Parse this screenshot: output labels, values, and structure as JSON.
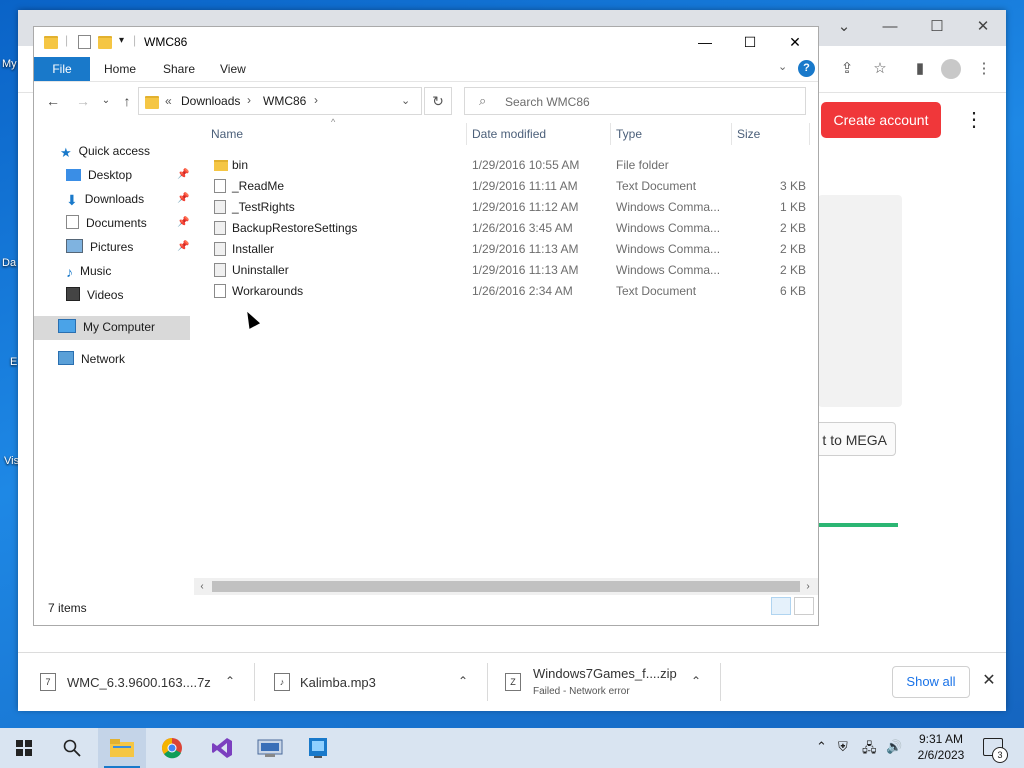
{
  "desktop": {
    "labels": [
      "My",
      "Da",
      "E",
      "Vis"
    ]
  },
  "chrome": {
    "create_account": "Create account",
    "mega_button": "t to MEGA",
    "downloads": [
      {
        "name": "WMC_6.3.9600.163....7z",
        "status": ""
      },
      {
        "name": "Kalimba.mp3",
        "status": ""
      },
      {
        "name": "Windows7Games_f....zip",
        "status": "Failed - Network error"
      }
    ],
    "show_all": "Show all"
  },
  "explorer": {
    "title": "WMC86",
    "ribbon": {
      "file": "File",
      "home": "Home",
      "share": "Share",
      "view": "View",
      "help": "?"
    },
    "address": {
      "prefix": "«",
      "crumbs": [
        "Downloads",
        "WMC86"
      ]
    },
    "search_placeholder": "Search WMC86",
    "nav": {
      "quick_access": "Quick access",
      "items": [
        "Desktop",
        "Downloads",
        "Documents",
        "Pictures",
        "Music",
        "Videos"
      ],
      "my_computer": "My Computer",
      "network": "Network"
    },
    "columns": {
      "name": "Name",
      "date": "Date modified",
      "type": "Type",
      "size": "Size"
    },
    "files": [
      {
        "name": "bin",
        "date": "1/29/2016 10:55 AM",
        "type": "File folder",
        "size": ""
      },
      {
        "name": "_ReadMe",
        "date": "1/29/2016 11:11 AM",
        "type": "Text Document",
        "size": "3 KB"
      },
      {
        "name": "_TestRights",
        "date": "1/29/2016 11:12 AM",
        "type": "Windows Comma...",
        "size": "1 KB"
      },
      {
        "name": "BackupRestoreSettings",
        "date": "1/26/2016 3:45 AM",
        "type": "Windows Comma...",
        "size": "2 KB"
      },
      {
        "name": "Installer",
        "date": "1/29/2016 11:13 AM",
        "type": "Windows Comma...",
        "size": "2 KB"
      },
      {
        "name": "Uninstaller",
        "date": "1/29/2016 11:13 AM",
        "type": "Windows Comma...",
        "size": "2 KB"
      },
      {
        "name": "Workarounds",
        "date": "1/26/2016 2:34 AM",
        "type": "Text Document",
        "size": "6 KB"
      }
    ],
    "status": "7 items"
  },
  "taskbar": {
    "time": "9:31 AM",
    "date": "2/6/2023",
    "notifications": "3"
  },
  "colors": {
    "accent": "#1979ca",
    "mega_red": "#f0373a",
    "folder": "#f5c644"
  }
}
